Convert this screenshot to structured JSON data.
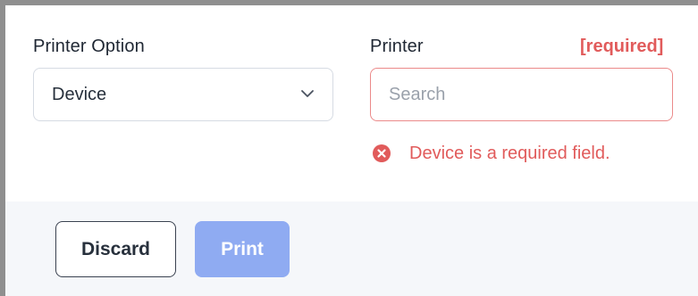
{
  "form": {
    "printer_option": {
      "label": "Printer Option",
      "selected_value": "Device"
    },
    "printer": {
      "label": "Printer",
      "required_tag": "[required]",
      "placeholder": "Search",
      "value": "",
      "error_message": "Device is a required field."
    }
  },
  "footer": {
    "discard_label": "Discard",
    "print_label": "Print",
    "print_disabled": true
  },
  "colors": {
    "error": "#e15b5b",
    "error_border": "#eb8a8a",
    "primary_disabled": "#8fabf2",
    "footer_background": "#f5f7fa"
  },
  "icons": {
    "select_caret": "chevron-down-icon",
    "error": "error-circle-x-icon"
  }
}
